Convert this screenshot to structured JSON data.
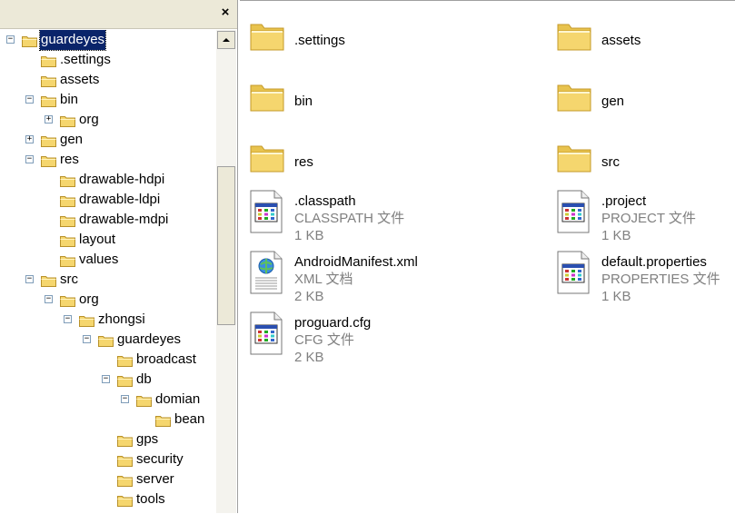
{
  "window": {
    "close_glyph": "×"
  },
  "tree": [
    {
      "label": "guardeyes",
      "expander": "−",
      "selected": true
    },
    {
      "label": ".settings",
      "expander": ""
    },
    {
      "label": "assets",
      "expander": ""
    },
    {
      "label": "bin",
      "expander": "−"
    },
    {
      "label": "org",
      "expander": "+"
    },
    {
      "label": "gen",
      "expander": "+"
    },
    {
      "label": "res",
      "expander": "−"
    },
    {
      "label": "drawable-hdpi",
      "expander": ""
    },
    {
      "label": "drawable-ldpi",
      "expander": ""
    },
    {
      "label": "drawable-mdpi",
      "expander": ""
    },
    {
      "label": "layout",
      "expander": ""
    },
    {
      "label": "values",
      "expander": ""
    },
    {
      "label": "src",
      "expander": "−"
    },
    {
      "label": "org",
      "expander": "−"
    },
    {
      "label": "zhongsi",
      "expander": "−"
    },
    {
      "label": "guardeyes",
      "expander": "−"
    },
    {
      "label": "broadcast",
      "expander": ""
    },
    {
      "label": "db",
      "expander": "−"
    },
    {
      "label": "domian",
      "expander": "−"
    },
    {
      "label": "bean",
      "expander": ""
    },
    {
      "label": "gps",
      "expander": ""
    },
    {
      "label": "security",
      "expander": ""
    },
    {
      "label": "server",
      "expander": ""
    },
    {
      "label": "tools",
      "expander": ""
    }
  ],
  "files": [
    {
      "name": ".settings",
      "kind": "folder"
    },
    {
      "name": "assets",
      "kind": "folder"
    },
    {
      "name": "bin",
      "kind": "folder"
    },
    {
      "name": "gen",
      "kind": "folder"
    },
    {
      "name": "res",
      "kind": "folder"
    },
    {
      "name": "src",
      "kind": "folder"
    },
    {
      "name": ".classpath",
      "type": "CLASSPATH 文件",
      "size": "1 KB",
      "kind": "doc"
    },
    {
      "name": ".project",
      "type": "PROJECT 文件",
      "size": "1 KB",
      "kind": "doc"
    },
    {
      "name": "AndroidManifest.xml",
      "type": "XML 文档",
      "size": "2 KB",
      "kind": "xml"
    },
    {
      "name": "default.properties",
      "type": "PROPERTIES 文件",
      "size": "1 KB",
      "kind": "doc"
    },
    {
      "name": "proguard.cfg",
      "type": "CFG 文件",
      "size": "2 KB",
      "kind": "doc"
    }
  ],
  "colors": {
    "folder": "#f5d66e",
    "selection": "#0a246a",
    "pane_bg": "#ece9d8"
  }
}
